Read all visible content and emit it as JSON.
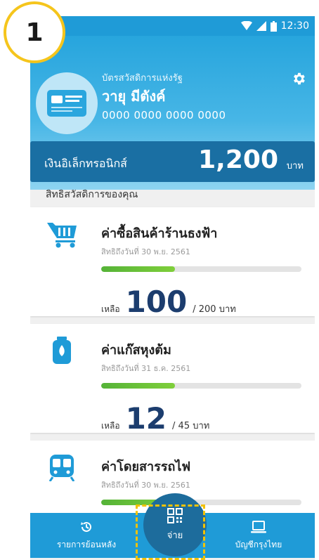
{
  "step_badge": "1",
  "status_bar": {
    "time": "12:30"
  },
  "header": {
    "card_type": "บัตรสวัสดิการแห่งรัฐ",
    "holder_name": "วายุ มีตังค์",
    "card_number": "0000 0000 0000 0000"
  },
  "balance": {
    "label": "เงินอิเล็กทรอนิกส์",
    "amount": "1,200",
    "unit": "บาท"
  },
  "section_title": "สิทธิสวัสดิการของคุณ",
  "benefits": [
    {
      "icon": "shopping-cart-icon",
      "title": "ค่าซื้อสินค้าร้านธงฟ้า",
      "expiry": "สิทธิถึงวันที่ 30 พ.ย. 2561",
      "progress": 0.37,
      "remain_label": "เหลือ",
      "remain_value": "100",
      "remain_total": "/ 200 บาท"
    },
    {
      "icon": "gas-cylinder-icon",
      "title": "ค่าแก๊สหุงต้ม",
      "expiry": "สิทธิถึงวันที่ 31 ธ.ค. 2561",
      "progress": 0.37,
      "remain_label": "เหลือ",
      "remain_value": "12",
      "remain_total": "/ 45 บาท"
    },
    {
      "icon": "train-icon",
      "title": "ค่าโดยสารรถไฟ",
      "expiry": "สิทธิถึงวันที่ 30 พ.ย. 2561",
      "progress": 0.37
    }
  ],
  "bottom_nav": {
    "history_label": "รายการย้อนหลัง",
    "pay_label": "จ่าย",
    "account_label": "บัญชีกรุงไทย"
  },
  "colors": {
    "primary": "#1f9bd7",
    "dark_blue": "#1a6fa3",
    "progress_green": "#55b338",
    "highlight_yellow": "#f2c200"
  }
}
